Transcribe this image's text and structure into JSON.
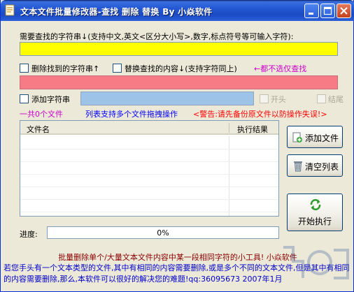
{
  "window": {
    "title": "文本文件批量修改器-查找 删除 替换 By 小焱软件"
  },
  "find": {
    "label": "需要查找的字符串↓(支持中文,英文<区分大小写>,数字,标点符号等可输入字符):",
    "value": ""
  },
  "options": {
    "delete_label": "删除找到的字符串↑",
    "replace_label": "替换查找的内容↓(支持字符同上)",
    "replace_hint": "←都不选仅查找",
    "replace_value": "",
    "add_label": "添加字符串",
    "add_value": "",
    "head_label": "开头",
    "tail_label": "结尾"
  },
  "info": {
    "file_count": "一共0个文件",
    "drag_hint": "列表支持多个文件拖拽操作",
    "warning": "<警告:请先备份原文件以防操作失误!>"
  },
  "list": {
    "columns": [
      "文件名",
      "执行结果"
    ],
    "rows": []
  },
  "buttons": {
    "add_file": "添加文件",
    "clear_list": "清空列表",
    "start": "开始执行"
  },
  "progress": {
    "label": "进度:",
    "value": 0,
    "text": "0%"
  },
  "footer": {
    "title": "批量删除单个/大量文本文件内容中某一段相同字符的小工具! 小焱软件",
    "description": "若您手头有一个文本类型的文件,其中有相同的内容需要删除,或是多个不同的文本文件,但是其中有相同的内容需要删除,那么,本软件可以很好的解决您的难题!qq:36095673 2007年1月"
  },
  "colors": {
    "find_field": "#ffff00",
    "replace_field": "#f77b84",
    "add_field": "#9dc3e8",
    "hint_purple": "#cc00cc",
    "info_blue": "#0000ff",
    "warning_red": "#ff0000"
  }
}
